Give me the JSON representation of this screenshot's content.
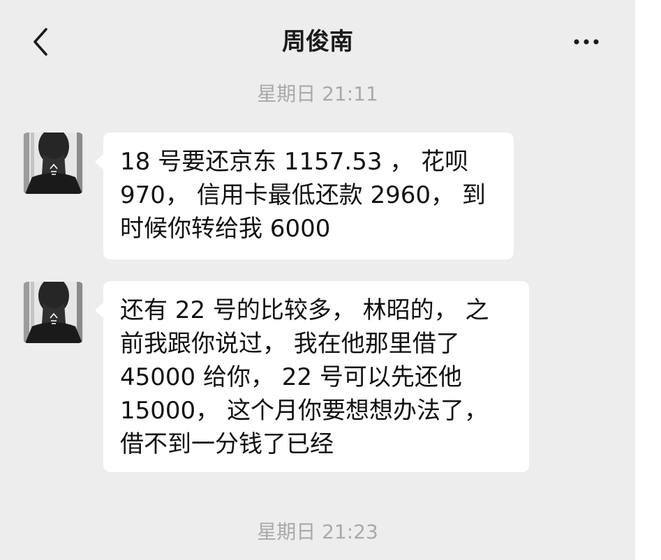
{
  "header": {
    "title": "周俊南",
    "back_icon": "chevron-left-icon",
    "more_icon": "more-horizontal-icon"
  },
  "timestamps": [
    "星期日 21:11",
    "星期日 21:23"
  ],
  "messages": [
    {
      "sender": "contact",
      "lines": [
        "18 号要还京东 1157.53 ， 花呗",
        "970， 信用卡最低还款 2960， 到",
        "时候你转给我 6000"
      ]
    },
    {
      "sender": "contact",
      "lines": [
        "还有 22 号的比较多， 林昭的， 之",
        "前我跟你说过， 我在他那里借了",
        "45000 给你， 22 号可以先还他",
        "15000， 这个月你要想想办法了，",
        "借不到一分钱了已经"
      ]
    }
  ],
  "colors": {
    "background": "#ededed",
    "bubble": "#ffffff",
    "timestamp_text": "#a9a9a9",
    "title_text": "#1b1b1b"
  }
}
